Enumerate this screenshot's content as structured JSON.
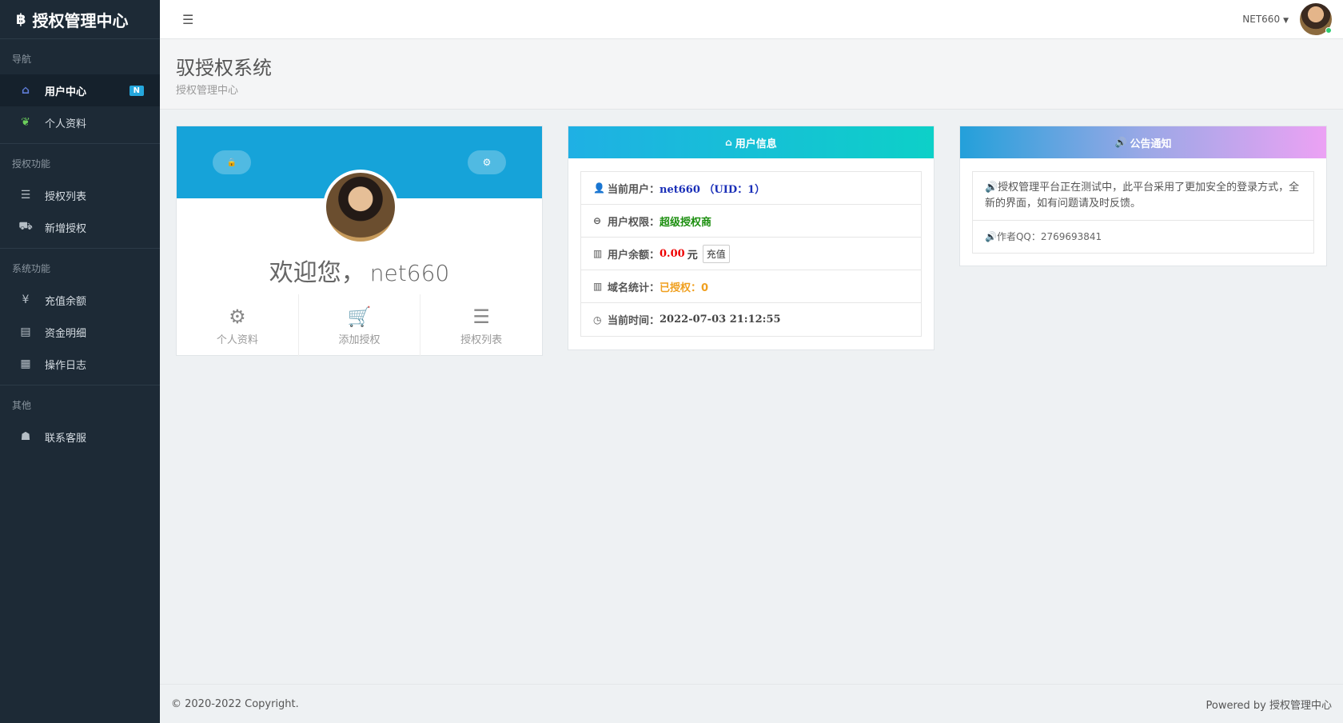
{
  "brand": {
    "logo": "฿",
    "title": "授权管理中心"
  },
  "sidebar": {
    "sections": [
      {
        "head": "导航",
        "items": [
          {
            "icon": "home-icon",
            "glyph": "⌂",
            "label": "用户中心",
            "badge": "N",
            "active": true
          },
          {
            "icon": "leaf-icon",
            "glyph": "❦",
            "label": "个人资料"
          }
        ]
      },
      {
        "head": "授权功能",
        "items": [
          {
            "icon": "list-icon",
            "glyph": "☰",
            "label": "授权列表"
          },
          {
            "icon": "cart-icon",
            "glyph": "⛟",
            "label": "新增授权"
          }
        ]
      },
      {
        "head": "系统功能",
        "items": [
          {
            "icon": "yen-icon",
            "glyph": "¥",
            "label": "充值余额"
          },
          {
            "icon": "ledger-icon",
            "glyph": "▤",
            "label": "资金明细"
          },
          {
            "icon": "calendar-icon",
            "glyph": "▦",
            "label": "操作日志"
          }
        ]
      },
      {
        "head": "其他",
        "items": [
          {
            "icon": "qq-icon",
            "glyph": "☗",
            "label": "联系客服"
          }
        ]
      }
    ]
  },
  "topbar": {
    "menu_glyph": "☰",
    "username": "NET660",
    "caret": "▼"
  },
  "header": {
    "title": "驭授权系统",
    "subtitle": "授权管理中心"
  },
  "profile_card": {
    "lock_glyph": "🔒",
    "gear_glyph": "⚙",
    "welcome": "欢迎您，",
    "name": "net660",
    "quick": [
      {
        "icon": "gear-icon",
        "glyph": "⚙",
        "label": "个人资料"
      },
      {
        "icon": "cart-icon",
        "glyph": "🛒",
        "label": "添加授权"
      },
      {
        "icon": "list-icon",
        "glyph": "☰",
        "label": "授权列表"
      }
    ]
  },
  "user_info": {
    "title": "用户信息",
    "title_glyph": "⌂",
    "current_user_label": "当前用户：",
    "current_user": "net660 （UID：1）",
    "level_label": "用户权限：",
    "level": "超级授权商",
    "balance_label": "用户余额：",
    "balance": "0.00",
    "balance_unit": "元",
    "recharge": "充值",
    "domain_label": "域名统计：",
    "domain_value": "已授权：0",
    "time_label": "当前时间：",
    "time": "2022-07-03 21:12:55"
  },
  "notice": {
    "title": "公告通知",
    "title_glyph": "🔊",
    "line1": "🔊授权管理平台正在测试中，此平台采用了更加安全的登录方式，全新的界面，如有问题请及时反馈。",
    "line2": "🔊作者QQ：2769693841"
  },
  "footer": {
    "copyright": "© 2020-2022 Copyright.",
    "powered": "Powered by 授权管理中心"
  }
}
